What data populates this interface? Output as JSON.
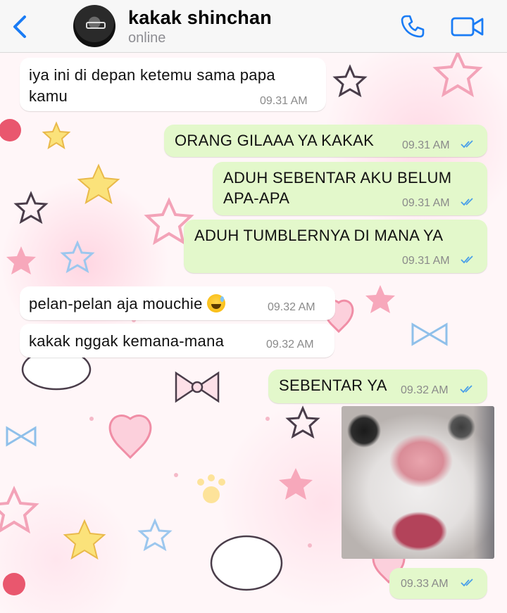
{
  "header": {
    "contact_name": "kakak shinchan",
    "status": "online",
    "icons": [
      "back-chevron-icon",
      "phone-icon",
      "video-camera-icon"
    ],
    "accent_color": "#1a7cf5"
  },
  "messages": [
    {
      "direction": "incoming",
      "lines": [
        "iya ini di depan ketemu sama papa",
        "kamu"
      ],
      "time": "09.31 AM"
    },
    {
      "direction": "outgoing",
      "lines": [
        "ORANG GILAAA YA KAKAK"
      ],
      "time": "09.31 AM",
      "read": true
    },
    {
      "direction": "outgoing",
      "lines": [
        "ADUH SEBENTAR AKU BELUM",
        "APA-APA"
      ],
      "time": "09.31 AM",
      "read": true
    },
    {
      "direction": "outgoing",
      "lines": [
        "ADUH TUMBLERNYA DI MANA YA"
      ],
      "time": "09.31 AM",
      "read": true
    },
    {
      "direction": "incoming",
      "lines": [
        "pelan-pelan aja mouchie"
      ],
      "emoji": "grinning-face-with-sweat",
      "time": "09.32 AM"
    },
    {
      "direction": "incoming",
      "lines": [
        "kakak nggak kemana-mana"
      ],
      "time": "09.32 AM"
    },
    {
      "direction": "outgoing",
      "lines": [
        "SEBENTAR YA"
      ],
      "time": "09.32 AM",
      "read": true
    },
    {
      "direction": "outgoing",
      "type": "image",
      "image": "cat-closeup-photo"
    },
    {
      "direction": "outgoing",
      "lines": [],
      "time": "09.33 AM",
      "read": true
    }
  ],
  "colors": {
    "incoming_bubble": "#ffffff",
    "outgoing_bubble": "#e3f8cb",
    "read_ticks": "#4a9fe8",
    "wallpaper": "#fff6f8"
  }
}
